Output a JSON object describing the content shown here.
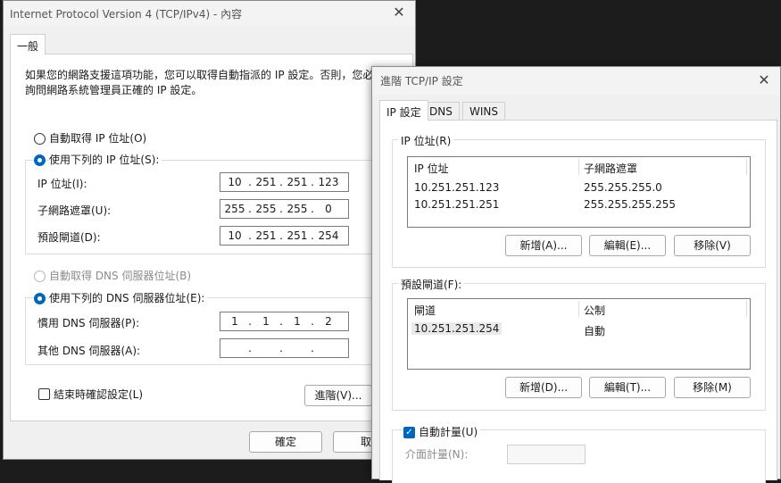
{
  "win1": {
    "title": "Internet Protocol Version 4 (TCP/IPv4) - 內容",
    "tab_general": "一般",
    "description_1": "如果您的網路支援這項功能，您可以取得自動指派的 IP 設定。否則，您必",
    "description_2": "詢問網路系統管理員正確的 IP 設定。",
    "radio_auto_ip": "自動取得 IP 位址(O)",
    "radio_manual_ip": "使用下列的 IP 位址(S):",
    "label_ip": "IP 位址(I):",
    "label_mask": "子網路遮罩(U):",
    "label_gateway": "預設閘道(D):",
    "ip": [
      "10",
      "251",
      "251",
      "123"
    ],
    "mask": [
      "255",
      "255",
      "255",
      "0"
    ],
    "gateway": [
      "10",
      "251",
      "251",
      "254"
    ],
    "radio_auto_dns": "自動取得 DNS 伺服器位址(B)",
    "radio_manual_dns": "使用下列的 DNS 伺服器位址(E):",
    "label_pref_dns": "慣用 DNS 伺服器(P):",
    "label_alt_dns": "其他 DNS 伺服器(A):",
    "pref_dns": [
      "1",
      "1",
      "1",
      "2"
    ],
    "alt_dns": [
      "",
      "",
      "",
      ""
    ],
    "dot": ".",
    "check_validate": "結束時確認設定(L)",
    "btn_advanced": "進階(V)...",
    "btn_ok": "確定",
    "btn_cancel": "取"
  },
  "win2": {
    "title": "進階 TCP/IP 設定",
    "tab_ip": "IP 設定",
    "tab_dns": "DNS",
    "tab_wins": "WINS",
    "group_ip": "IP 位址(R)",
    "col_ip": "IP 位址",
    "col_mask": "子網路遮罩",
    "ip_rows": [
      {
        "ip": "10.251.251.123",
        "mask": "255.255.255.0"
      },
      {
        "ip": "10.251.251.251",
        "mask": "255.255.255.255"
      }
    ],
    "btn_add_ip": "新增(A)...",
    "btn_edit_ip": "編輯(E)...",
    "btn_remove_ip": "移除(V)",
    "group_gw": "預設閘道(F):",
    "col_gw": "閘道",
    "col_metric": "公制",
    "gw_rows": [
      {
        "gw": "10.251.251.254",
        "metric": "自動"
      }
    ],
    "btn_add_gw": "新增(D)...",
    "btn_edit_gw": "編輯(T)...",
    "btn_remove_gw": "移除(M)",
    "check_auto_metric": "自動計量(U)",
    "label_iface_metric": "介面計量(N):"
  },
  "icons": {
    "close": "✕",
    "check": "✓"
  }
}
